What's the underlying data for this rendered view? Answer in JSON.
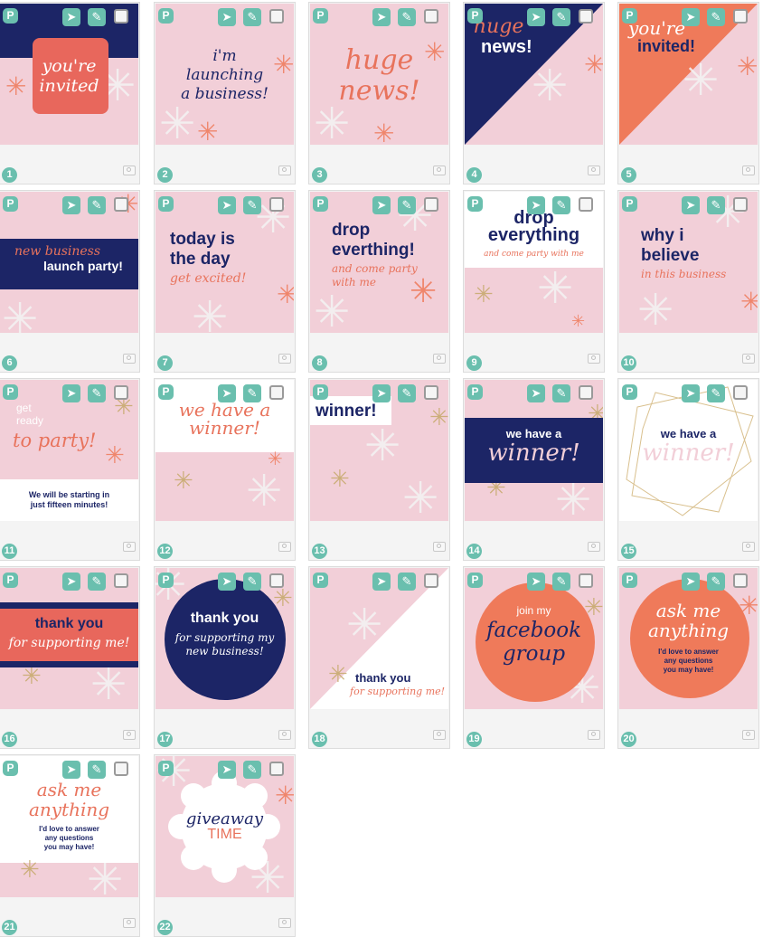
{
  "colors": {
    "navy": "#1c2566",
    "coral": "#ef7a5a",
    "pink": "#f2cfd8",
    "teal": "#6abfae",
    "white": "#ffffff"
  },
  "icons": {
    "pin": "pinterest-icon",
    "share": "share-icon",
    "edit": "pencil-icon",
    "select": "checkbox",
    "camera": "camera-icon"
  },
  "cards": [
    {
      "num": "1",
      "lines": [
        "you're",
        "invited"
      ]
    },
    {
      "num": "2",
      "lines": [
        "i'm",
        "launching",
        "a business!"
      ]
    },
    {
      "num": "3",
      "lines": [
        "huge",
        "news!"
      ]
    },
    {
      "num": "4",
      "lines": [
        "huge",
        "news!"
      ]
    },
    {
      "num": "5",
      "lines": [
        "you're",
        "invited!"
      ]
    },
    {
      "num": "6",
      "lines": [
        "new business",
        "launch party!"
      ]
    },
    {
      "num": "7",
      "lines": [
        "today is",
        "the day",
        "get excited!"
      ]
    },
    {
      "num": "8",
      "lines": [
        "drop",
        "everthing!",
        "and come party",
        "with me"
      ]
    },
    {
      "num": "9",
      "lines": [
        "drop",
        "everything",
        "and come party with me"
      ]
    },
    {
      "num": "10",
      "lines": [
        "why i",
        "believe",
        "in this business"
      ]
    },
    {
      "num": "11",
      "lines": [
        "get",
        "ready",
        "to party!",
        "We will be starting in",
        "just fifteen minutes!"
      ]
    },
    {
      "num": "12",
      "lines": [
        "we have a",
        "winner!"
      ]
    },
    {
      "num": "13",
      "lines": [
        "winner!"
      ]
    },
    {
      "num": "14",
      "lines": [
        "we have a",
        "winner!"
      ]
    },
    {
      "num": "15",
      "lines": [
        "we have a",
        "winner!"
      ]
    },
    {
      "num": "16",
      "lines": [
        "thank you",
        "for supporting me!"
      ]
    },
    {
      "num": "17",
      "lines": [
        "thank you",
        "for supporting my",
        "new business!"
      ]
    },
    {
      "num": "18",
      "lines": [
        "thank you",
        "for supporting me!"
      ]
    },
    {
      "num": "19",
      "lines": [
        "join my",
        "facebook",
        "group"
      ]
    },
    {
      "num": "20",
      "lines": [
        "ask me",
        "anything",
        "I'd love to answer",
        "any questions",
        "you may have!"
      ]
    },
    {
      "num": "21",
      "lines": [
        "ask me",
        "anything",
        "I'd love to answer",
        "any questions",
        "you may have!"
      ]
    },
    {
      "num": "22",
      "lines": [
        "giveaway",
        "TIME"
      ]
    }
  ]
}
